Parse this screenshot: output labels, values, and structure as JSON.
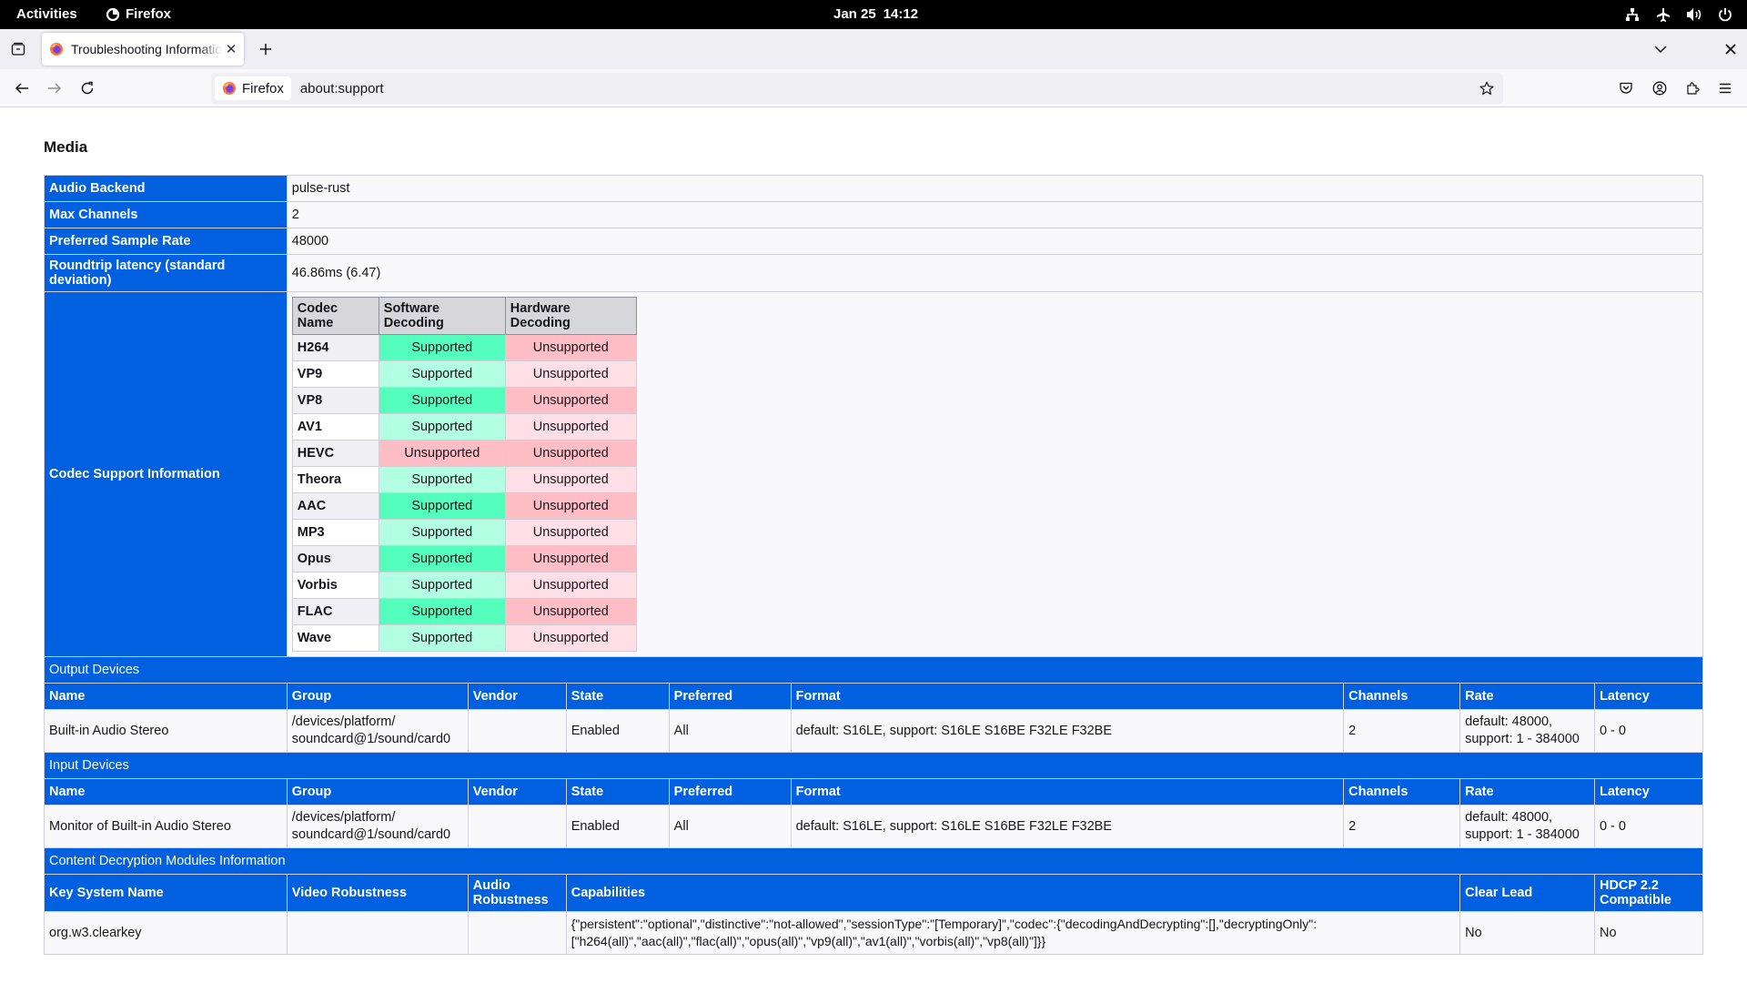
{
  "system_bar": {
    "activities": "Activities",
    "app_name": "Firefox",
    "date": "Jan 25",
    "time": "14:12"
  },
  "browser": {
    "tab_title": "Troubleshooting Information",
    "identity_label": "Firefox",
    "url": "about:support"
  },
  "page": {
    "section_title": "Media",
    "audio_rows": [
      {
        "key": "Audio Backend",
        "value": "pulse-rust"
      },
      {
        "key": "Max Channels",
        "value": "2"
      },
      {
        "key": "Preferred Sample Rate",
        "value": "48000"
      },
      {
        "key": "Roundtrip latency (standard deviation)",
        "value": "46.86ms (6.47)"
      }
    ],
    "codec_label": "Codec Support Information",
    "codec_headers": [
      "Codec Name",
      "Software Decoding",
      "Hardware Decoding"
    ],
    "codecs": [
      {
        "name": "H264",
        "software": "Supported",
        "hardware": "Unsupported"
      },
      {
        "name": "VP9",
        "software": "Supported",
        "hardware": "Unsupported"
      },
      {
        "name": "VP8",
        "software": "Supported",
        "hardware": "Unsupported"
      },
      {
        "name": "AV1",
        "software": "Supported",
        "hardware": "Unsupported"
      },
      {
        "name": "HEVC",
        "software": "Unsupported",
        "hardware": "Unsupported"
      },
      {
        "name": "Theora",
        "software": "Supported",
        "hardware": "Unsupported"
      },
      {
        "name": "AAC",
        "software": "Supported",
        "hardware": "Unsupported"
      },
      {
        "name": "MP3",
        "software": "Supported",
        "hardware": "Unsupported"
      },
      {
        "name": "Opus",
        "software": "Supported",
        "hardware": "Unsupported"
      },
      {
        "name": "Vorbis",
        "software": "Supported",
        "hardware": "Unsupported"
      },
      {
        "name": "FLAC",
        "software": "Supported",
        "hardware": "Unsupported"
      },
      {
        "name": "Wave",
        "software": "Supported",
        "hardware": "Unsupported"
      }
    ],
    "device_columns": [
      "Name",
      "Group",
      "Vendor",
      "State",
      "Preferred",
      "Format",
      "Channels",
      "Rate",
      "Latency"
    ],
    "output_devices": {
      "title": "Output Devices",
      "name": "Built-in Audio Stereo",
      "group_line1": "/devices/platform/",
      "group_line2": "soundcard@1/sound/card0",
      "vendor": "",
      "state": "Enabled",
      "preferred": "All",
      "format": "default: S16LE, support: S16LE S16BE F32LE F32BE",
      "channels": "2",
      "rate_line1": "default: 48000,",
      "rate_line2": "support: 1 - 384000",
      "latency": "0 - 0"
    },
    "input_devices": {
      "title": "Input Devices",
      "name": "Monitor of Built-in Audio Stereo",
      "group_line1": "/devices/platform/",
      "group_line2": "soundcard@1/sound/card0",
      "vendor": "",
      "state": "Enabled",
      "preferred": "All",
      "format": "default: S16LE, support: S16LE S16BE F32LE F32BE",
      "channels": "2",
      "rate_line1": "default: 48000,",
      "rate_line2": "support: 1 - 384000",
      "latency": "0 - 0"
    },
    "cdm": {
      "title": "Content Decryption Modules Information",
      "columns": [
        "Key System Name",
        "Video Robustness",
        "Audio Robustness",
        "Capabilities",
        "Clear Lead",
        "HDCP 2.2 Compatible"
      ],
      "key_system": "org.w3.clearkey",
      "video_robustness": "",
      "audio_robustness": "",
      "capabilities_line1": "{\"persistent\":\"optional\",\"distinctive\":\"not-allowed\",\"sessionType\":\"[Temporary]\",\"codec\":{\"decodingAndDecrypting\":[],\"decryptingOnly\":",
      "capabilities_line2": "[\"h264(all)\",\"aac(all)\",\"flac(all)\",\"opus(all)\",\"vp9(all)\",\"av1(all)\",\"vorbis(all)\",\"vp8(all)\"]}}",
      "clear_lead": "No",
      "hdcp": "No"
    }
  },
  "colors": {
    "header_blue": "#0060df",
    "supported": "#54ffbd",
    "supported_alt": "#b3ffe3",
    "unsupported": "#ffbdc5",
    "unsupported_alt": "#ffdfe7"
  },
  "icons": [
    "firefox-logo-icon",
    "tabs-list-icon",
    "close-icon",
    "plus-icon",
    "chevron-down-icon",
    "back-arrow-icon",
    "forward-arrow-icon",
    "reload-icon",
    "star-icon",
    "pocket-icon",
    "account-icon",
    "extensions-icon",
    "hamburger-menu-icon",
    "network-icon",
    "airplane-icon",
    "volume-icon",
    "power-icon"
  ]
}
